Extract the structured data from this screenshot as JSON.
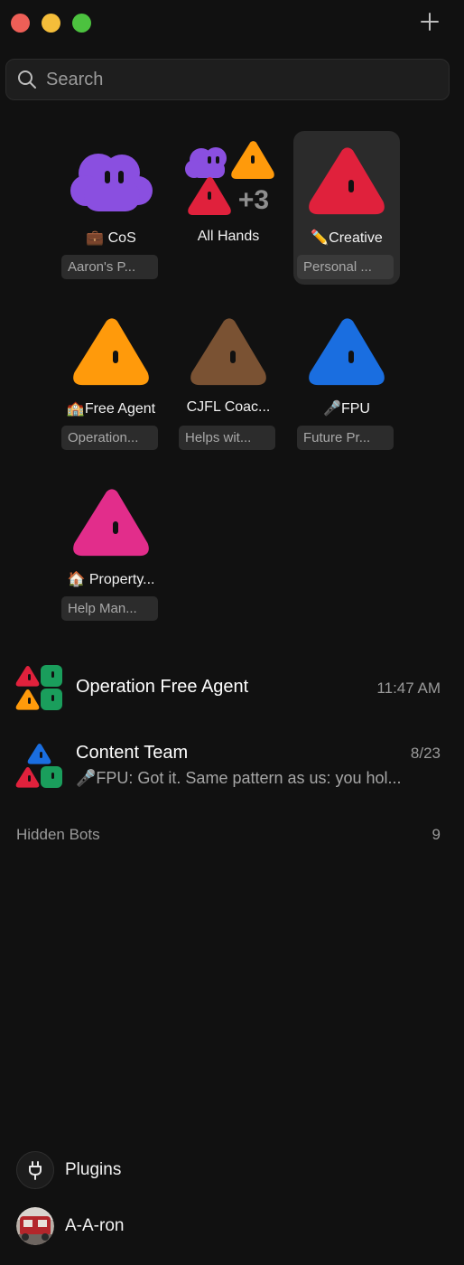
{
  "search": {
    "placeholder": "Search"
  },
  "bots": [
    {
      "emoji": "💼",
      "name": "CoS",
      "description": "Aaron's P...",
      "color": "#8a4fe0",
      "shape": "cloud-avatar",
      "selected": false
    },
    {
      "emoji": "",
      "name": "All Hands",
      "description": "",
      "extra_count": "+3",
      "shape": "group-avatar",
      "selected": false
    },
    {
      "emoji": "✏️",
      "name": "Creative",
      "description": "Personal ...",
      "color": "#e0213c",
      "shape": "triangle-avatar",
      "selected": true
    },
    {
      "emoji": "🏫",
      "name": "Free Agent",
      "description": "Operation...",
      "color": "#ff9a0b",
      "shape": "triangle-avatar",
      "selected": false
    },
    {
      "emoji": "",
      "name": "CJFL Coac...",
      "description": "Helps wit...",
      "color": "#7a5233",
      "shape": "triangle-avatar",
      "selected": false
    },
    {
      "emoji": "🎤",
      "name": "FPU",
      "description": "Future Pr...",
      "color": "#1a6ee0",
      "shape": "triangle-avatar",
      "selected": false
    },
    {
      "emoji": "🏠",
      "name": "Property...",
      "description": "Help Man...",
      "color": "#e22d8b",
      "shape": "triangle-avatar",
      "selected": false
    }
  ],
  "conversations": [
    {
      "title": "Operation Free Agent",
      "time": "11:47 AM",
      "preview": ""
    },
    {
      "title": "Content Team",
      "time": "8/23",
      "preview": "🎤FPU: Got it. Same pattern as us: you hol..."
    }
  ],
  "hidden_bots": {
    "label": "Hidden Bots",
    "count": "9"
  },
  "plugins": {
    "label": "Plugins"
  },
  "user": {
    "name": "A-A-ron"
  },
  "colors": {
    "background": "#111111",
    "red": "#e0213c",
    "orange": "#ff9a0b",
    "green": "#1a9e5c",
    "blue": "#1a6ee0",
    "purple": "#8a4fe0"
  }
}
